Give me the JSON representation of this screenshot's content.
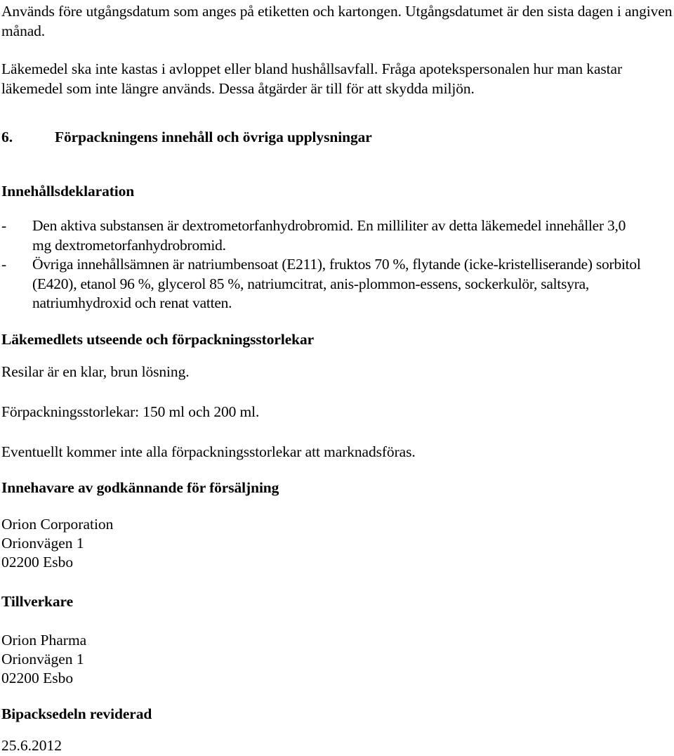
{
  "document": {
    "type": "package-leaflet",
    "language": "sv"
  },
  "disposal": {
    "expiry_paragraph": "Används före utgångsdatum som anges på etiketten och kartongen. Utgångsdatumet är den sista dagen i angiven månad.",
    "waste_paragraph": "Läkemedel ska inte kastas i avloppet eller bland hushållsavfall. Fråga apotekspersonalen hur man kastar läkemedel som inte längre används. Dessa åtgärder är till för att skydda miljön."
  },
  "section6": {
    "number": "6.",
    "title": "Förpackningens innehåll och övriga upplysningar"
  },
  "contents": {
    "heading": "Innehållsdeklaration",
    "bullet_mark": "-",
    "items": [
      "Den aktiva substansen är dextrometorfanhydrobromid. En milliliter av detta läkemedel innehåller 3,0 mg dextrometorfanhydrobromid.",
      "Övriga innehållsämnen är natriumbensoat (E211), fruktos 70 %, flytande (icke-kristelliserande) sorbitol (E420), etanol 96 %, glycerol 85 %, natriumcitrat, anis-plommon-essens, sockerkulör, saltsyra, natriumhydroxid och renat vatten."
    ]
  },
  "appearance": {
    "heading": "Läkemedlets utseende och förpackningsstorlekar",
    "description": "Resilar är en klar, brun lösning.",
    "pack_sizes": "Förpackningsstorlekar: 150 ml och 200 ml.",
    "marketing_note": "Eventuellt kommer inte alla förpackningsstorlekar att marknadsföras."
  },
  "mah": {
    "heading": "Innehavare av godkännande för försäljning",
    "name": "Orion Corporation",
    "street": "Orionvägen 1",
    "city": "02200 Esbo"
  },
  "manufacturer": {
    "heading": "Tillverkare",
    "name": "Orion Pharma",
    "street": "Orionvägen 1",
    "city": "02200 Esbo"
  },
  "revision": {
    "heading": "Bipacksedeln reviderad",
    "date": "25.6.2012"
  }
}
